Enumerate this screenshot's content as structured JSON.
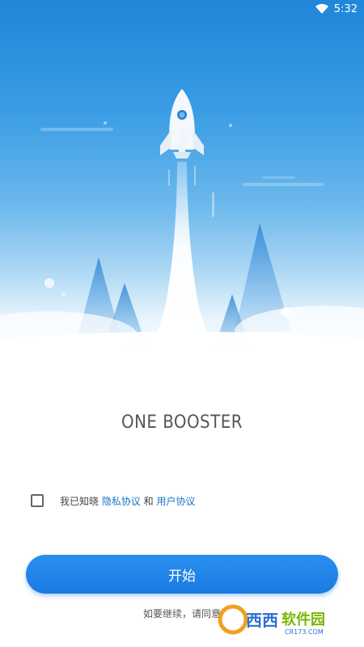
{
  "status_bar": {
    "time": "5:32",
    "icons": [
      "wifi-icon"
    ]
  },
  "app": {
    "name": "ONE BOOSTER"
  },
  "agreement": {
    "prefix": "我已知晓 ",
    "privacy_link": "隐私协议",
    "connector": " 和 ",
    "user_link": "用户协议",
    "checked": false
  },
  "start_button": {
    "label": "开始"
  },
  "footer": {
    "text": "如要继续，请同意"
  },
  "watermark": {
    "text": "西西软件园",
    "sub": "CR173.COM"
  },
  "colors": {
    "primary": "#1a7be3",
    "link": "#1a73c8",
    "sky_top": "#1f86d9"
  }
}
